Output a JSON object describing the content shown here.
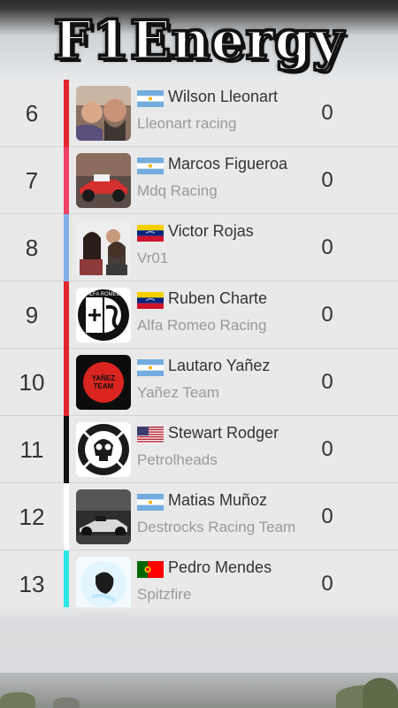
{
  "app": {
    "title": "F1Energy"
  },
  "standings": [
    {
      "position": "6",
      "driver": "Wilson Lleonart",
      "team": "Lleonart racing",
      "points": "0",
      "flag": "argentina",
      "stripe": "#e3262b",
      "avatar": "photo-two-people"
    },
    {
      "position": "7",
      "driver": "Marcos Figueroa",
      "team": "Mdq Racing",
      "points": "0",
      "flag": "argentina",
      "stripe": "#ee3f64",
      "avatar": "photo-race-car"
    },
    {
      "position": "8",
      "driver": "Victor Rojas",
      "team": "Vr01",
      "points": "0",
      "flag": "venezuela",
      "stripe": "#7fb2ea",
      "avatar": "photo-family"
    },
    {
      "position": "9",
      "driver": "Ruben Charte",
      "team": "Alfa Romeo Racing",
      "points": "0",
      "flag": "venezuela",
      "stripe": "#e3262b",
      "avatar": "alfa-romeo-logo"
    },
    {
      "position": "10",
      "driver": "Lautaro Yañez",
      "team": "Yañez Team",
      "points": "0",
      "flag": "argentina",
      "stripe": "#e3262b",
      "avatar": "yanez-team-logo",
      "avatar_text": "YAÑEZ TEAM"
    },
    {
      "position": "11",
      "driver": "Stewart Rodger",
      "team": "Petrolheads",
      "points": "0",
      "flag": "united-states",
      "stripe": "#111111",
      "avatar": "petrolheads-skull-logo"
    },
    {
      "position": "12",
      "driver": "Matias Muñoz",
      "team": "Destrocks Racing Team",
      "points": "0",
      "flag": "argentina",
      "stripe": "#ffffff",
      "avatar": "photo-f1-car"
    },
    {
      "position": "13",
      "driver": "Pedro Mendes",
      "team": "Spitzfire",
      "points": "0",
      "flag": "portugal",
      "stripe": "#2de6e8",
      "avatar": "photo-glowing-figure"
    }
  ]
}
